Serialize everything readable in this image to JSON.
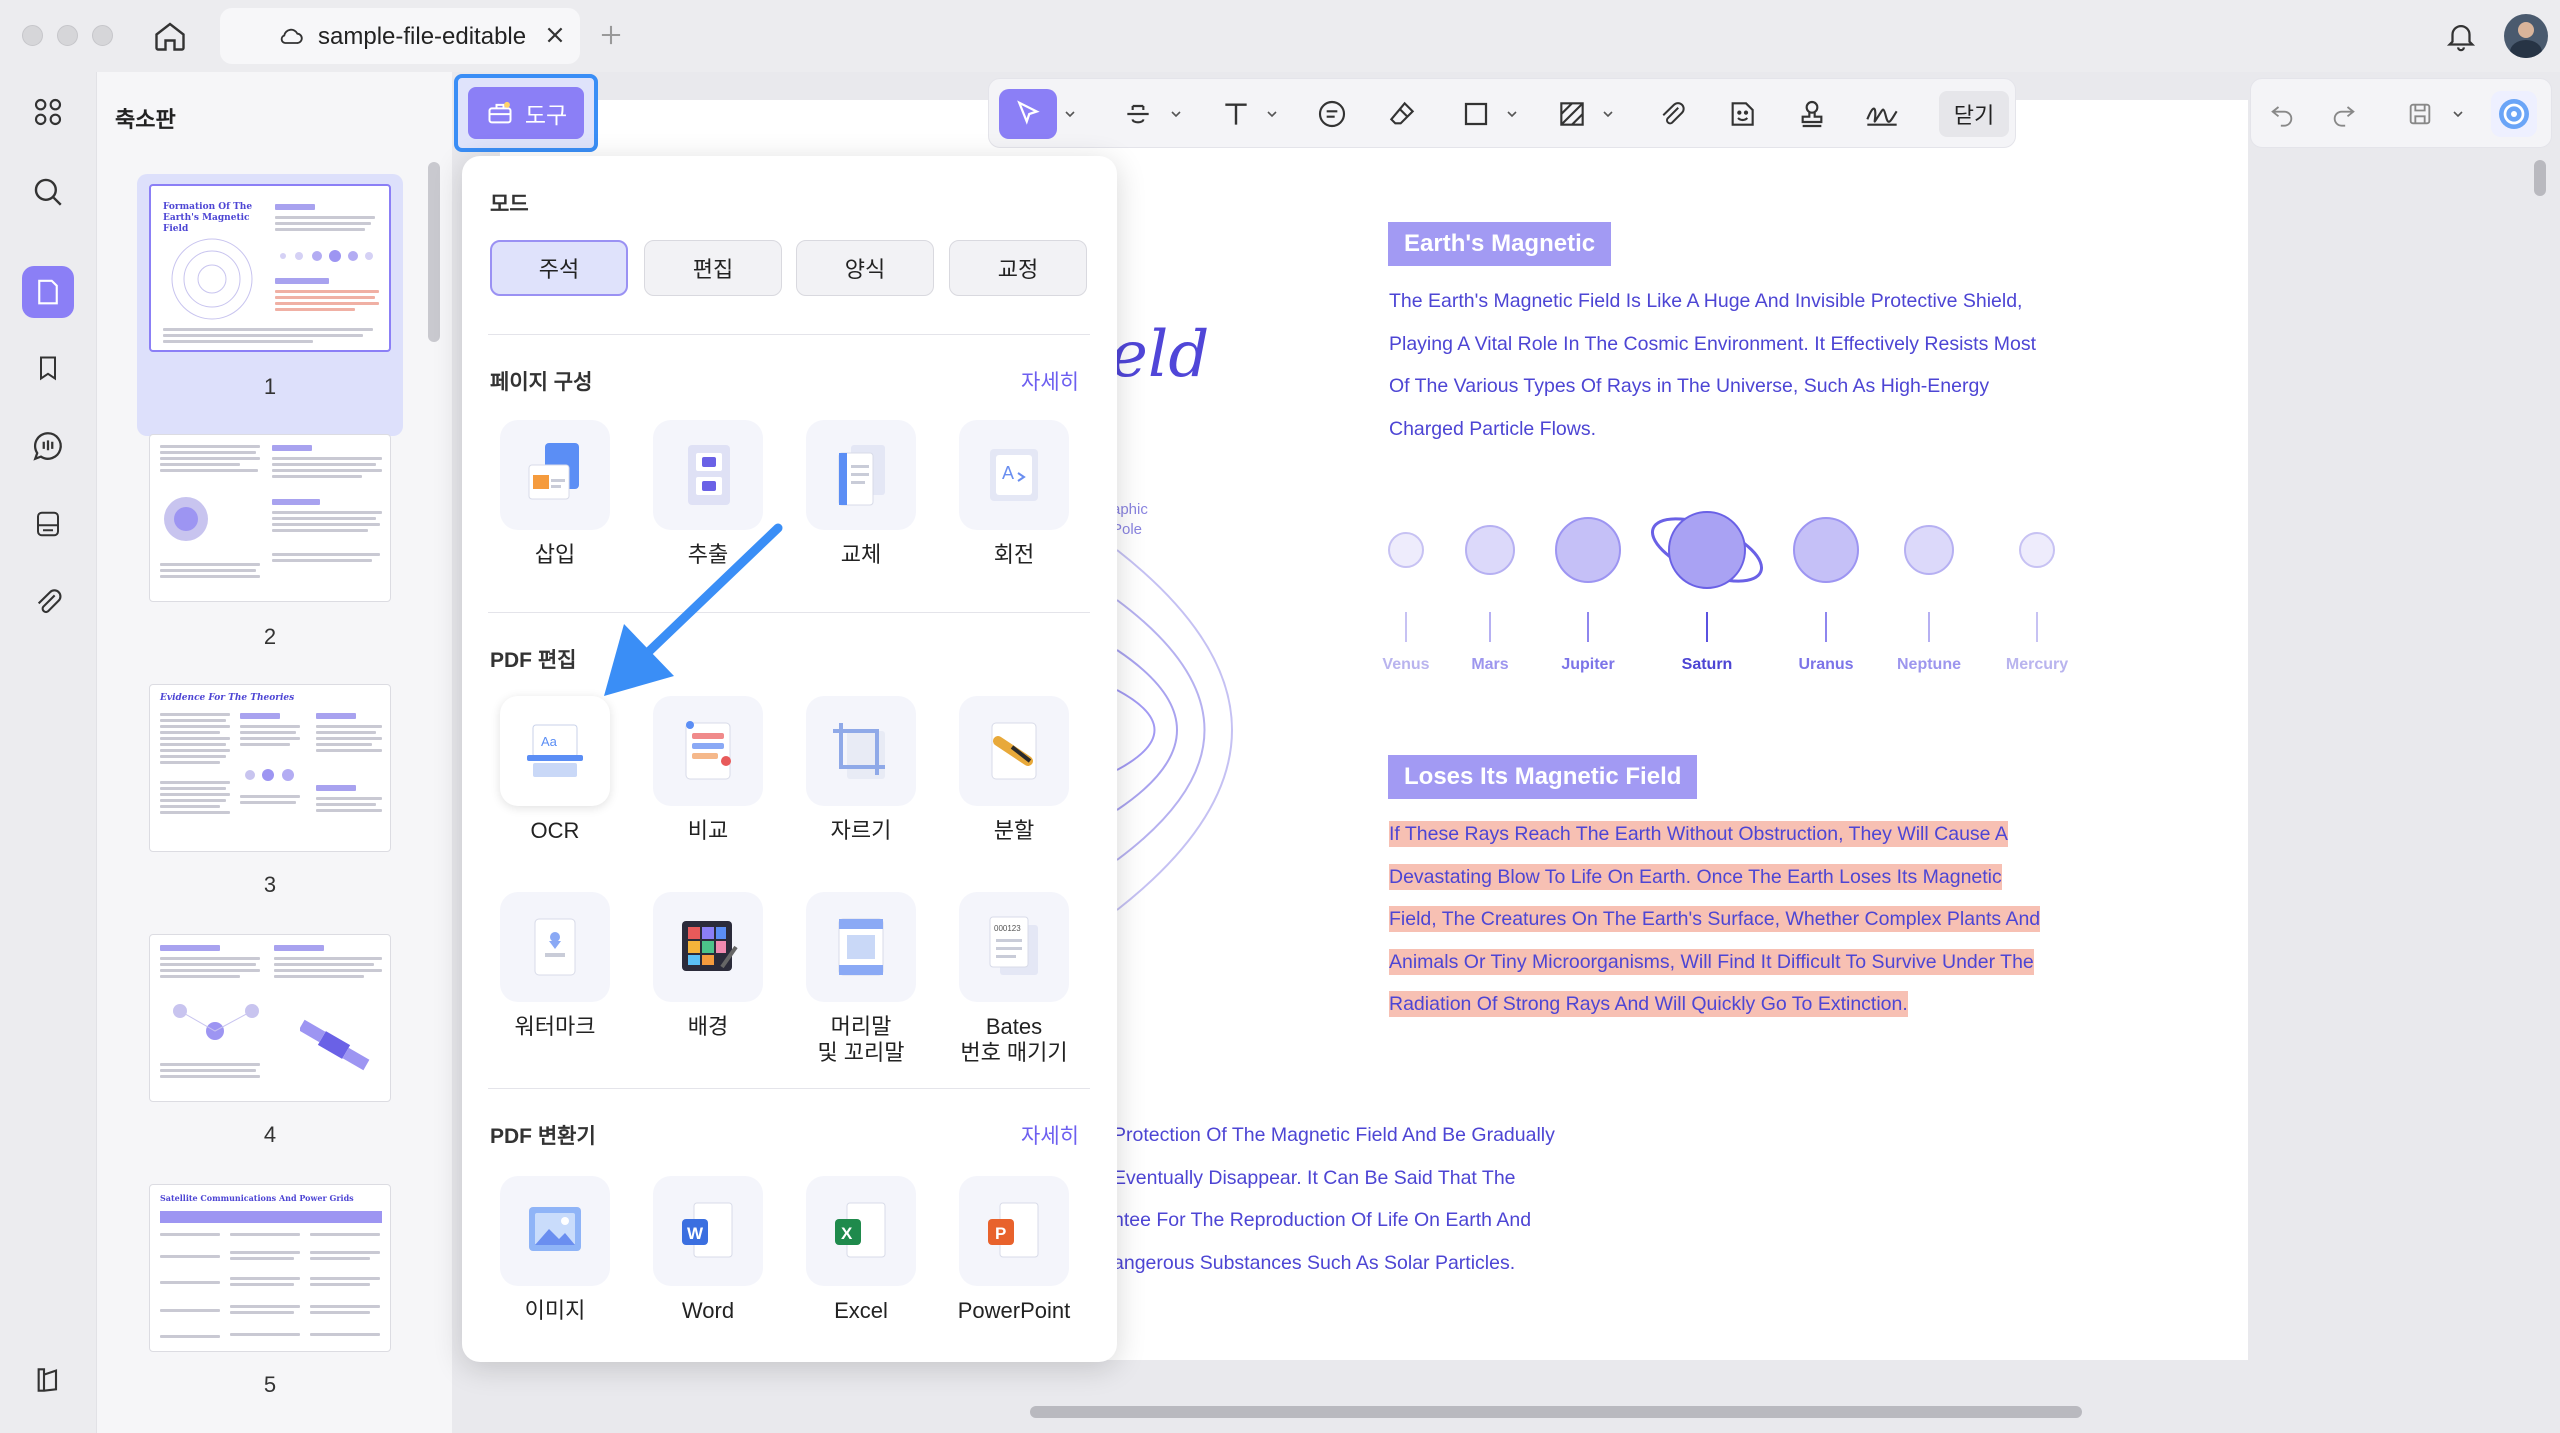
{
  "window": {
    "tab_title": "sample-file-editable"
  },
  "sidebar": {
    "title": "축소판",
    "pages": [
      "1",
      "2",
      "3",
      "4",
      "5"
    ]
  },
  "thumbnails": {
    "p1_title": "Formation Of The Earth's Magnetic Field",
    "p3_title": "Evidence For The Theories",
    "p5_title": "Satellite Communications And Power Grids"
  },
  "tools_button": {
    "label": "도구"
  },
  "toolbar": {
    "close_label": "닫기"
  },
  "panel": {
    "mode_title": "모드",
    "modes": [
      "주석",
      "편집",
      "양식",
      "교정"
    ],
    "page_section": {
      "title": "페이지 구성",
      "more": "자세히",
      "items": [
        "삽입",
        "추출",
        "교체",
        "회전"
      ]
    },
    "edit_section": {
      "title": "PDF 편집",
      "items": [
        "OCR",
        "비교",
        "자르기",
        "분할",
        "워터마크",
        "배경",
        "머리말\n및 꼬리말",
        "Bates\n번호 매기기"
      ]
    },
    "convert_section": {
      "title": "PDF 변환기",
      "more": "자세히",
      "items": [
        "이미지",
        "Word",
        "Excel",
        "PowerPoint"
      ]
    }
  },
  "document": {
    "title_fragment": "eld",
    "graphic_pole": "aphic\nPole",
    "heading1": "Earth's Magnetic",
    "para1": [
      "The Earth's Magnetic Field Is Like A Huge And Invisible Protective Shield,",
      "Playing A Vital Role In The Cosmic Environment. It Effectively Resists Most",
      "Of The Various Types Of Rays in The Universe, Such As High-Energy",
      "Charged Particle Flows."
    ],
    "planets": [
      "Venus",
      "Mars",
      "Jupiter",
      "Saturn",
      "Uranus",
      "Neptune",
      "Mercury"
    ],
    "heading2": "Loses Its Magnetic Field",
    "para2": [
      "If These Rays Reach The Earth Without Obstruction, They Will Cause A",
      "Devastating Blow To Life On Earth. Once The Earth Loses Its Magnetic",
      "Field, The Creatures On The Earth's Surface, Whether Complex Plants And",
      "Animals Or Tiny Microorganisms, Will Find It Difficult To Survive Under The",
      "Radiation Of Strong Rays And Will Quickly Go To Extinction."
    ],
    "para3": [
      "Protection Of The Magnetic Field And Be Gradually",
      "Eventually Disappear. It Can Be Said That The",
      "ntee For The Reproduction Of Life On Earth And",
      "angerous Substances Such As Solar Particles."
    ]
  },
  "colors": {
    "accent": "#8b7ff6",
    "highlight_blue": "#3a8ef6",
    "doc_text": "#4d45d4",
    "text_highlight": "#f7c0b3"
  }
}
